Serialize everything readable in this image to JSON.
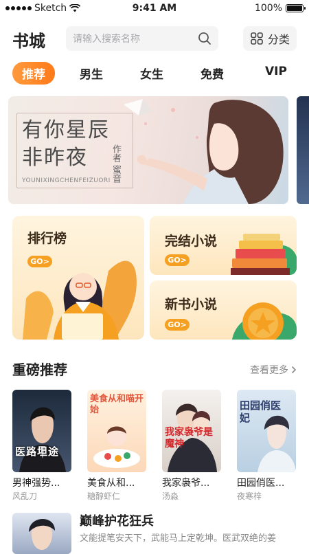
{
  "status_bar": {
    "carrier": "Sketch",
    "time": "9:41 AM",
    "battery": "100%"
  },
  "header": {
    "title": "书城",
    "search_placeholder": "请输入搜索名称",
    "category_label": "分类"
  },
  "tabs": [
    {
      "label": "推荐",
      "active": true
    },
    {
      "label": "男生",
      "active": false
    },
    {
      "label": "女生",
      "active": false
    },
    {
      "label": "免费",
      "active": false
    },
    {
      "label": "VIP",
      "active": false
    }
  ],
  "banner": {
    "title_line1": "有你星辰",
    "title_line2": "非昨夜",
    "author": "作者 蜜音",
    "pinyin": "YOUNIXINGCHENFEIZUORI"
  },
  "features": {
    "ranking": {
      "label": "排行榜",
      "go": "GO>"
    },
    "completed": {
      "label": "完结小说",
      "go": "GO>"
    },
    "new": {
      "label": "新书小说",
      "go": "GO>"
    }
  },
  "section": {
    "title": "重磅推荐",
    "more": "查看更多"
  },
  "books": [
    {
      "title": "男神强势...",
      "author": "风乱刀",
      "cover_text": "医路坦途"
    },
    {
      "title": "美食从和...",
      "author": "糖醇虾仁",
      "cover_text": "美食从和喵开始"
    },
    {
      "title": "我家袅爷...",
      "author": "汤淼",
      "cover_text": "我家袅爷是魔神"
    },
    {
      "title": "田园俏医...",
      "author": "夜寒梓",
      "cover_text": "田园俏医妃"
    }
  ],
  "featured": {
    "title": "巅峰护花狂兵",
    "description": "文能提笔安天下，武能马上定乾坤。医武双绝的姜"
  },
  "colors": {
    "accent": "#ff8a25",
    "go_badge": "#f5a021"
  }
}
